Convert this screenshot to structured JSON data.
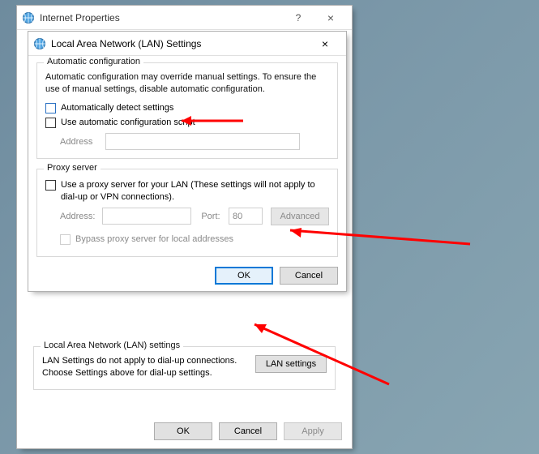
{
  "parent": {
    "title": "Internet Properties",
    "helpGlyph": "?",
    "closeGlyph": "×",
    "lan_section": {
      "legend": "Local Area Network (LAN) settings",
      "desc": "LAN Settings do not apply to dial-up connections. Choose Settings above for dial-up settings.",
      "button": "LAN settings"
    },
    "buttons": {
      "ok": "OK",
      "cancel": "Cancel",
      "apply": "Apply"
    }
  },
  "dialog": {
    "title": "Local Area Network (LAN) Settings",
    "closeGlyph": "×",
    "auto": {
      "legend": "Automatic configuration",
      "desc": "Automatic configuration may override manual settings.  To ensure the use of manual settings, disable automatic configuration.",
      "detect": "Automatically detect settings",
      "script": "Use automatic configuration script",
      "addressLabel": "Address",
      "addressValue": ""
    },
    "proxy": {
      "legend": "Proxy server",
      "use": "Use a proxy server for your LAN (These settings will not apply to dial-up or VPN connections).",
      "addressLabel": "Address:",
      "addressValue": "",
      "portLabel": "Port:",
      "portValue": "80",
      "advanced": "Advanced",
      "bypass": "Bypass proxy server for local addresses"
    },
    "buttons": {
      "ok": "OK",
      "cancel": "Cancel"
    }
  }
}
